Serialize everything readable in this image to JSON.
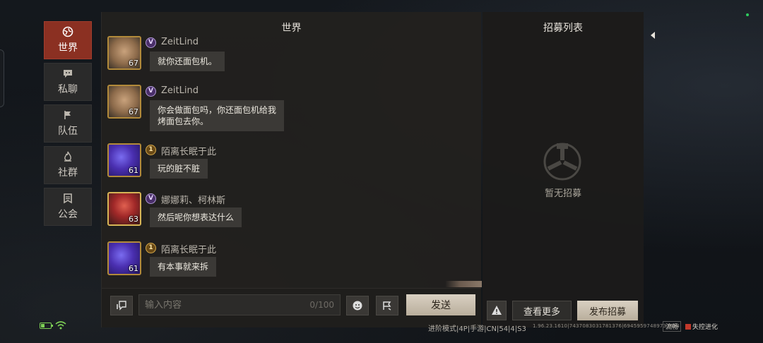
{
  "nav": {
    "items": [
      {
        "label": "世界",
        "icon": "globe-icon",
        "active": true
      },
      {
        "label": "私聊",
        "icon": "chat-bubble-icon",
        "active": false
      },
      {
        "label": "队伍",
        "icon": "flag-icon",
        "active": false
      },
      {
        "label": "社群",
        "icon": "flame-icon",
        "active": false
      },
      {
        "label": "公会",
        "icon": "banner-icon",
        "active": false
      }
    ]
  },
  "chat": {
    "title": "世界",
    "messages": [
      {
        "name": "ZeitLind",
        "badge": "V",
        "level": "67",
        "text_lines": [
          "就你还面包机。"
        ]
      },
      {
        "name": "ZeitLind",
        "badge": "V",
        "level": "67",
        "text_lines": [
          "你会做面包吗，你还面包机给我",
          "烤面包去你。"
        ]
      },
      {
        "name": "陌离长眠于此",
        "badge": "1",
        "level": "61",
        "text_lines": [
          "玩的脏不脏"
        ]
      },
      {
        "name": "娜娜莉、柯林斯",
        "badge": "V",
        "level": "63",
        "text_lines": [
          "然后呢你想表达什么"
        ]
      },
      {
        "name": "陌离长眠于此",
        "badge": "1",
        "level": "61",
        "text_lines": [
          "有本事就来拆"
        ]
      }
    ],
    "input": {
      "placeholder": "输入内容",
      "counter": "0/100"
    },
    "send_label": "发送"
  },
  "recruit": {
    "title": "招募列表",
    "empty_text": "暂无招募",
    "more_label": "查看更多",
    "post_label": "发布招募"
  },
  "status": {
    "mode_text": "进阶模式|4P|手游|CN|54|4|S3",
    "version_text": "1.96.23.1610|7437083031781376|69459597489733634",
    "fluency_label": "流畅",
    "brand_text": "失控进化"
  },
  "colors": {
    "active_tab": "#8b3022",
    "primary_button": "#d9d0c2",
    "battery": "#7dcf55"
  }
}
